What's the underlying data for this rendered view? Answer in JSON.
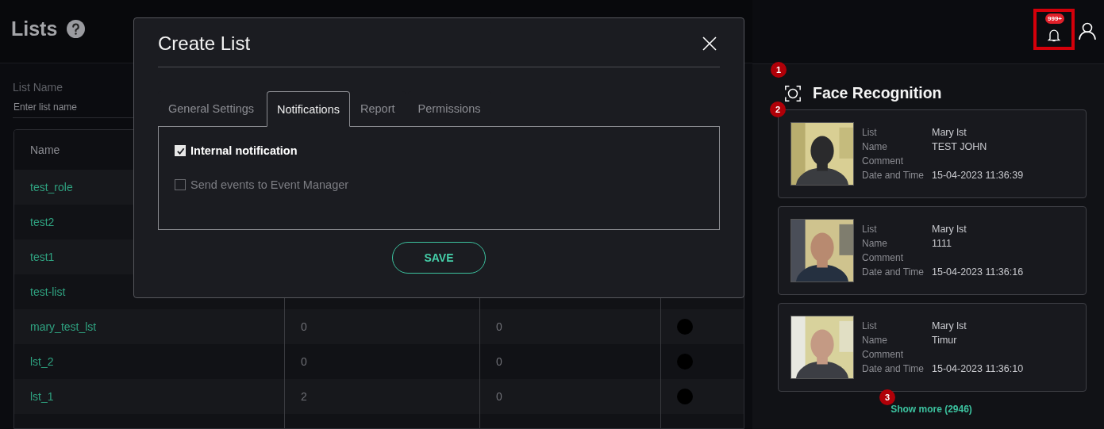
{
  "page": {
    "title": "Lists"
  },
  "filter": {
    "label": "List Name",
    "placeholder": "Enter list name"
  },
  "table": {
    "columns": [
      "Name"
    ],
    "rows": [
      {
        "cells": [
          "test_role"
        ]
      },
      {
        "cells": [
          "test2"
        ]
      },
      {
        "cells": [
          "test1"
        ]
      },
      {
        "cells": [
          "test-list"
        ]
      },
      {
        "cells": [
          "mary_test_lst",
          "0",
          "0"
        ]
      },
      {
        "cells": [
          "lst_2",
          "0",
          "0"
        ]
      },
      {
        "cells": [
          "lst_1",
          "2",
          "0"
        ]
      }
    ]
  },
  "modal": {
    "title": "Create List",
    "tabs": [
      {
        "label": "General Settings",
        "selected": false
      },
      {
        "label": "Notifications",
        "selected": true
      },
      {
        "label": "Report",
        "selected": false
      },
      {
        "label": "Permissions",
        "selected": false
      }
    ],
    "options": [
      {
        "label": "Internal notification",
        "checked": true
      },
      {
        "label": "Send events to Event Manager",
        "checked": false
      }
    ],
    "save": "SAVE"
  },
  "header": {
    "notification_badge": "999+"
  },
  "panel": {
    "title": "Face Recognition",
    "cards": [
      {
        "fields": [
          {
            "label": "List",
            "value": "Mary lst"
          },
          {
            "label": "Name",
            "value": "TEST JOHN"
          },
          {
            "label": "Comment"
          },
          {
            "label": "Date and Time",
            "value": "15-04-2023 11:36:39"
          }
        ]
      },
      {
        "fields": [
          {
            "label": "List",
            "value": "Mary lst"
          },
          {
            "label": "Name",
            "value": "1111"
          },
          {
            "label": "Comment"
          },
          {
            "label": "Date and Time",
            "value": "15-04-2023 11:36:16"
          }
        ]
      },
      {
        "fields": [
          {
            "label": "List",
            "value": "Mary lst"
          },
          {
            "label": "Name",
            "value": "Timur"
          },
          {
            "label": "Comment"
          },
          {
            "label": "Date and Time",
            "value": "15-04-2023 11:36:10"
          }
        ]
      }
    ],
    "show_more": "Show more (2946)"
  },
  "annotations": [
    {
      "label": "1"
    },
    {
      "label": "2"
    },
    {
      "label": "3"
    }
  ]
}
